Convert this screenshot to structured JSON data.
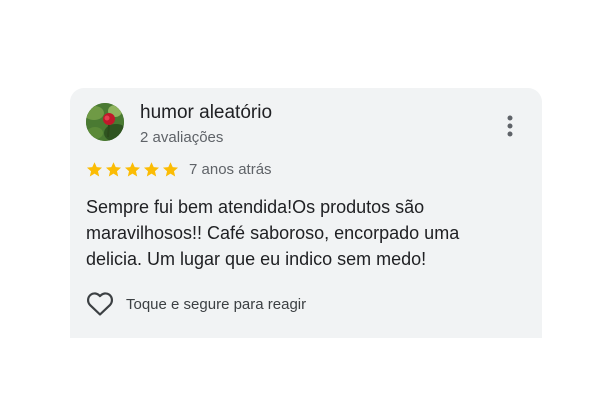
{
  "review": {
    "author": {
      "name": "humor aleatório",
      "review_count": "2 avaliações",
      "avatar_icon": "profile-photo-flower"
    },
    "rating": {
      "stars": 5,
      "max_stars": 5,
      "star_color": "#fbbc04"
    },
    "date": "7 anos atrás",
    "text": "Sempre fui bem atendida!Os produtos são maravilhosos!! Café saboroso, encorpado uma delicia. Um lugar que eu indico sem medo!",
    "menu_icon": "more-vert-icon",
    "react": {
      "icon": "heart-outline-icon",
      "label": "Toque e segure para reagir"
    }
  },
  "colors": {
    "card_background": "#f1f3f4",
    "primary_text": "#202124",
    "secondary_text": "#5f6368"
  }
}
